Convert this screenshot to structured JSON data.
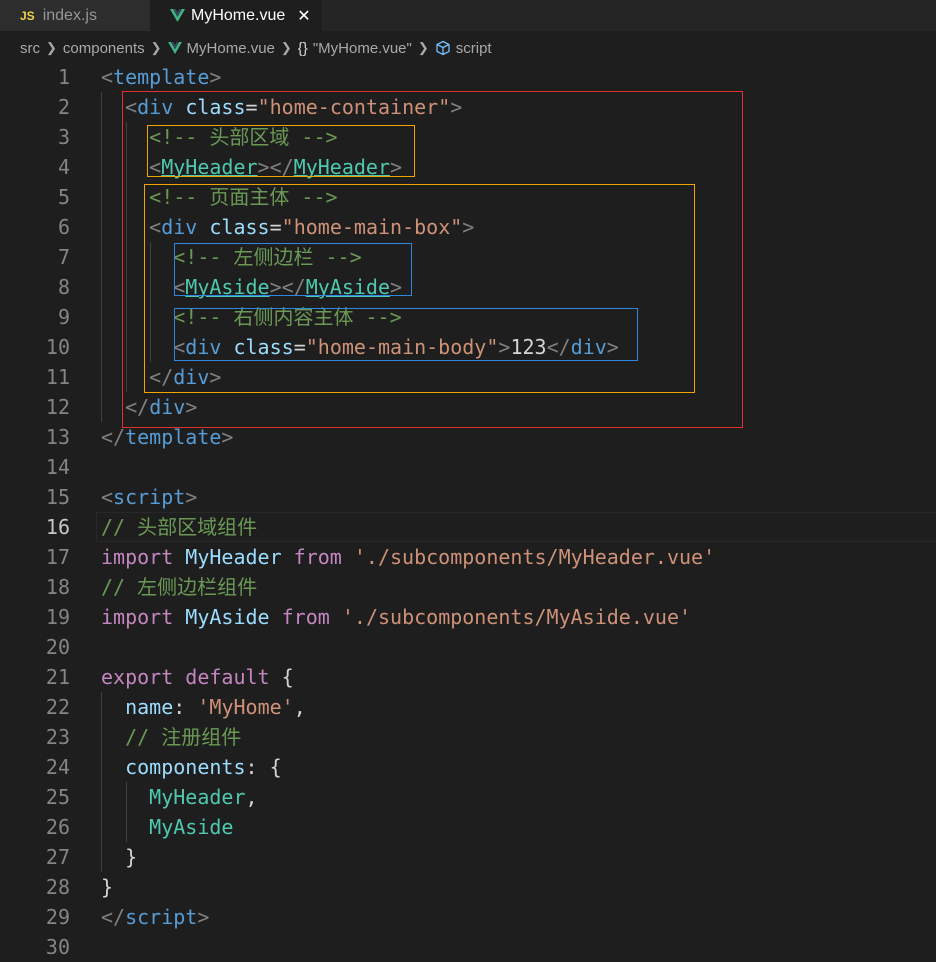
{
  "tabs": [
    {
      "label": "index.js",
      "icon": "js-icon",
      "icon_text": "JS",
      "active": false
    },
    {
      "label": "MyHome.vue",
      "icon": "vue-icon",
      "active": true
    }
  ],
  "breadcrumb": [
    "src",
    "components",
    "MyHome.vue",
    "\"MyHome.vue\"",
    "script"
  ],
  "current_line": 16,
  "colors": {
    "annotation_red": "#e03131",
    "annotation_orange": "#f0a500",
    "annotation_blue": "#2e86de"
  },
  "lines": [
    {
      "n": "1",
      "tokens": [
        [
          "t-tag",
          "<"
        ],
        [
          "t-name",
          "template"
        ],
        [
          "t-tag",
          ">"
        ]
      ]
    },
    {
      "n": "2",
      "tokens": [
        [
          "t-txt",
          "  "
        ],
        [
          "t-tag",
          "<"
        ],
        [
          "t-name",
          "div"
        ],
        [
          "t-txt",
          " "
        ],
        [
          "t-attr",
          "class"
        ],
        [
          "t-txt",
          "="
        ],
        [
          "t-str",
          "\"home-container\""
        ],
        [
          "t-tag",
          ">"
        ]
      ]
    },
    {
      "n": "3",
      "tokens": [
        [
          "t-txt",
          "    "
        ],
        [
          "t-com",
          "<!-- 头部区域 -->"
        ]
      ]
    },
    {
      "n": "4",
      "tokens": [
        [
          "t-txt",
          "    "
        ],
        [
          "t-tag",
          "<"
        ],
        [
          "t-comp",
          "MyHeader"
        ],
        [
          "t-tag",
          "></"
        ],
        [
          "t-comp",
          "MyHeader"
        ],
        [
          "t-tag",
          ">"
        ]
      ]
    },
    {
      "n": "5",
      "tokens": [
        [
          "t-txt",
          "    "
        ],
        [
          "t-com",
          "<!-- 页面主体 -->"
        ]
      ]
    },
    {
      "n": "6",
      "tokens": [
        [
          "t-txt",
          "    "
        ],
        [
          "t-tag",
          "<"
        ],
        [
          "t-name",
          "div"
        ],
        [
          "t-txt",
          " "
        ],
        [
          "t-attr",
          "class"
        ],
        [
          "t-txt",
          "="
        ],
        [
          "t-str",
          "\"home-main-box\""
        ],
        [
          "t-tag",
          ">"
        ]
      ]
    },
    {
      "n": "7",
      "tokens": [
        [
          "t-txt",
          "      "
        ],
        [
          "t-com",
          "<!-- 左侧边栏 -->"
        ]
      ]
    },
    {
      "n": "8",
      "tokens": [
        [
          "t-txt",
          "      "
        ],
        [
          "t-tag",
          "<"
        ],
        [
          "t-comp",
          "MyAside"
        ],
        [
          "t-tag",
          "></"
        ],
        [
          "t-comp",
          "MyAside"
        ],
        [
          "t-tag",
          ">"
        ]
      ]
    },
    {
      "n": "9",
      "tokens": [
        [
          "t-txt",
          "      "
        ],
        [
          "t-com",
          "<!-- 右侧内容主体 -->"
        ]
      ]
    },
    {
      "n": "10",
      "tokens": [
        [
          "t-txt",
          "      "
        ],
        [
          "t-tag",
          "<"
        ],
        [
          "t-name",
          "div"
        ],
        [
          "t-txt",
          " "
        ],
        [
          "t-attr",
          "class"
        ],
        [
          "t-txt",
          "="
        ],
        [
          "t-str",
          "\"home-main-body\""
        ],
        [
          "t-tag",
          ">"
        ],
        [
          "t-txt",
          "123"
        ],
        [
          "t-tag",
          "</"
        ],
        [
          "t-name",
          "div"
        ],
        [
          "t-tag",
          ">"
        ]
      ]
    },
    {
      "n": "11",
      "tokens": [
        [
          "t-txt",
          "    "
        ],
        [
          "t-tag",
          "</"
        ],
        [
          "t-name",
          "div"
        ],
        [
          "t-tag",
          ">"
        ]
      ]
    },
    {
      "n": "12",
      "tokens": [
        [
          "t-txt",
          "  "
        ],
        [
          "t-tag",
          "</"
        ],
        [
          "t-name",
          "div"
        ],
        [
          "t-tag",
          ">"
        ]
      ]
    },
    {
      "n": "13",
      "tokens": [
        [
          "t-tag",
          "</"
        ],
        [
          "t-name",
          "template"
        ],
        [
          "t-tag",
          ">"
        ]
      ]
    },
    {
      "n": "14",
      "tokens": []
    },
    {
      "n": "15",
      "tokens": [
        [
          "t-tag",
          "<"
        ],
        [
          "t-name",
          "script"
        ],
        [
          "t-tag",
          ">"
        ]
      ]
    },
    {
      "n": "16",
      "tokens": [
        [
          "t-com",
          "// 头部区域组件"
        ]
      ]
    },
    {
      "n": "17",
      "tokens": [
        [
          "t-kw",
          "import"
        ],
        [
          "t-txt",
          " "
        ],
        [
          "t-id",
          "MyHeader"
        ],
        [
          "t-txt",
          " "
        ],
        [
          "t-kw",
          "from"
        ],
        [
          "t-txt",
          " "
        ],
        [
          "t-str",
          "'./subcomponents/MyHeader.vue'"
        ]
      ]
    },
    {
      "n": "18",
      "tokens": [
        [
          "t-com",
          "// 左侧边栏组件"
        ]
      ]
    },
    {
      "n": "19",
      "tokens": [
        [
          "t-kw",
          "import"
        ],
        [
          "t-txt",
          " "
        ],
        [
          "t-id",
          "MyAside"
        ],
        [
          "t-txt",
          " "
        ],
        [
          "t-kw",
          "from"
        ],
        [
          "t-txt",
          " "
        ],
        [
          "t-str",
          "'./subcomponents/MyAside.vue'"
        ]
      ]
    },
    {
      "n": "20",
      "tokens": []
    },
    {
      "n": "21",
      "tokens": [
        [
          "t-kw",
          "export"
        ],
        [
          "t-txt",
          " "
        ],
        [
          "t-kw",
          "default"
        ],
        [
          "t-txt",
          " {"
        ]
      ]
    },
    {
      "n": "22",
      "tokens": [
        [
          "t-txt",
          "  "
        ],
        [
          "t-id",
          "name"
        ],
        [
          "t-txt",
          ": "
        ],
        [
          "t-str",
          "'MyHome'"
        ],
        [
          "t-txt",
          ","
        ]
      ]
    },
    {
      "n": "23",
      "tokens": [
        [
          "t-txt",
          "  "
        ],
        [
          "t-com",
          "// 注册组件"
        ]
      ]
    },
    {
      "n": "24",
      "tokens": [
        [
          "t-txt",
          "  "
        ],
        [
          "t-id",
          "components"
        ],
        [
          "t-txt",
          ": {"
        ]
      ]
    },
    {
      "n": "25",
      "tokens": [
        [
          "t-txt",
          "    "
        ],
        [
          "t-cls",
          "MyHeader"
        ],
        [
          "t-txt",
          ","
        ]
      ]
    },
    {
      "n": "26",
      "tokens": [
        [
          "t-txt",
          "    "
        ],
        [
          "t-cls",
          "MyAside"
        ]
      ]
    },
    {
      "n": "27",
      "tokens": [
        [
          "t-txt",
          "  }"
        ]
      ]
    },
    {
      "n": "28",
      "tokens": [
        [
          "t-txt",
          "}"
        ]
      ]
    },
    {
      "n": "29",
      "tokens": [
        [
          "t-tag",
          "</"
        ],
        [
          "t-name",
          "script"
        ],
        [
          "t-tag",
          ">"
        ]
      ]
    },
    {
      "n": "30",
      "tokens": []
    }
  ]
}
